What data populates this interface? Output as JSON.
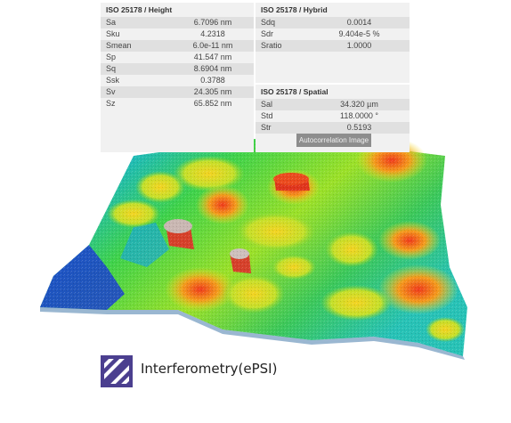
{
  "height": {
    "title": "ISO 25178 / Height",
    "rows": [
      {
        "label": "Sa",
        "value": "6.7096 nm"
      },
      {
        "label": "Sku",
        "value": "4.2318"
      },
      {
        "label": "Smean",
        "value": "6.0e-11 nm"
      },
      {
        "label": "Sp",
        "value": "41.547 nm"
      },
      {
        "label": "Sq",
        "value": "8.6904 nm"
      },
      {
        "label": "Ssk",
        "value": "0.3788"
      },
      {
        "label": "Sv",
        "value": "24.305 nm"
      },
      {
        "label": "Sz",
        "value": "65.852 nm"
      }
    ]
  },
  "hybrid": {
    "title": "ISO 25178 / Hybrid",
    "rows": [
      {
        "label": "Sdq",
        "value": "0.0014"
      },
      {
        "label": "Sdr",
        "value": "9.404e-5 %"
      },
      {
        "label": "Sratio",
        "value": "1.0000"
      }
    ]
  },
  "spatial": {
    "title": "ISO 25178 / Spatial",
    "rows": [
      {
        "label": "Sal",
        "value": "34.320 µm"
      },
      {
        "label": "Std",
        "value": "118.0000 °"
      },
      {
        "label": "Str",
        "value": "0.5193"
      }
    ],
    "button_label": "Autocorrelation Image"
  },
  "brand": {
    "name": "Interferometry(ePSI)",
    "logo_icon": "diagonal-stripes-icon",
    "logo_color": "#4b3f8f"
  }
}
